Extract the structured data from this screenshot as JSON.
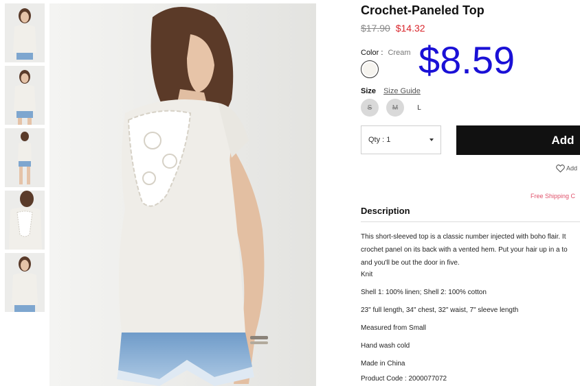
{
  "product": {
    "title": "Crochet-Paneled Top",
    "old_price": "$17.90",
    "sale_price": "$14.32",
    "overlay_price": "$8.59"
  },
  "color": {
    "label": "Color",
    "separator": ":",
    "value": "Cream",
    "swatch_color": "#f6f4ef"
  },
  "size": {
    "label": "Size",
    "guide_label": "Size Guide",
    "options": [
      {
        "label": "S",
        "available": false
      },
      {
        "label": "M",
        "available": false
      },
      {
        "label": "L",
        "available": true
      }
    ]
  },
  "quantity": {
    "label": "Qty : 1"
  },
  "actions": {
    "add_label": "Add",
    "wishlist_label": "Add",
    "free_shipping": "Free Shipping C"
  },
  "description": {
    "heading": "Description",
    "lines": [
      "This short-sleeved top is a classic number injected with boho flair. It",
      "crochet panel on its back with a vented hem. Put your hair up in a to",
      "and you'll be out the door in five."
    ],
    "specs": [
      "Knit",
      "Shell 1: 100% linen; Shell 2: 100% cotton",
      "23\" full length, 34\" chest, 32\" waist, 7\" sleeve length",
      "Measured from Small",
      "Hand wash cold",
      "Made in China",
      "Product Code : 2000077072"
    ]
  },
  "colors": {
    "sale": "#d9262c",
    "overlay": "#1a10d6",
    "button": "#111111",
    "free_shipping": "#e0516a"
  }
}
